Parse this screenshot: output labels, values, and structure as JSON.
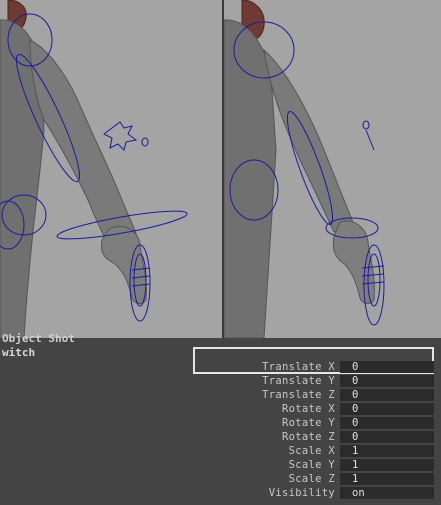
{
  "channel_box": {
    "cut_off_text": "Object Shot",
    "object_name": "witch",
    "highlighted_attribute": "Translate X",
    "attributes": [
      {
        "label": "Translate X",
        "value": "0"
      },
      {
        "label": "Translate Y",
        "value": "0"
      },
      {
        "label": "Translate Z",
        "value": "0"
      },
      {
        "label": "Rotate X",
        "value": "0"
      },
      {
        "label": "Rotate Y",
        "value": "0"
      },
      {
        "label": "Rotate Z",
        "value": "0"
      },
      {
        "label": "Scale X",
        "value": "1"
      },
      {
        "label": "Scale Y",
        "value": "1"
      },
      {
        "label": "Scale Z",
        "value": "1"
      },
      {
        "label": "Visibility",
        "value": "on"
      }
    ]
  },
  "colors": {
    "viewport_background": "#a4a4a4",
    "panel_background": "#444444",
    "rig_control_curves": "#1c1c9a",
    "highlight_border": "#e6e6e6"
  }
}
